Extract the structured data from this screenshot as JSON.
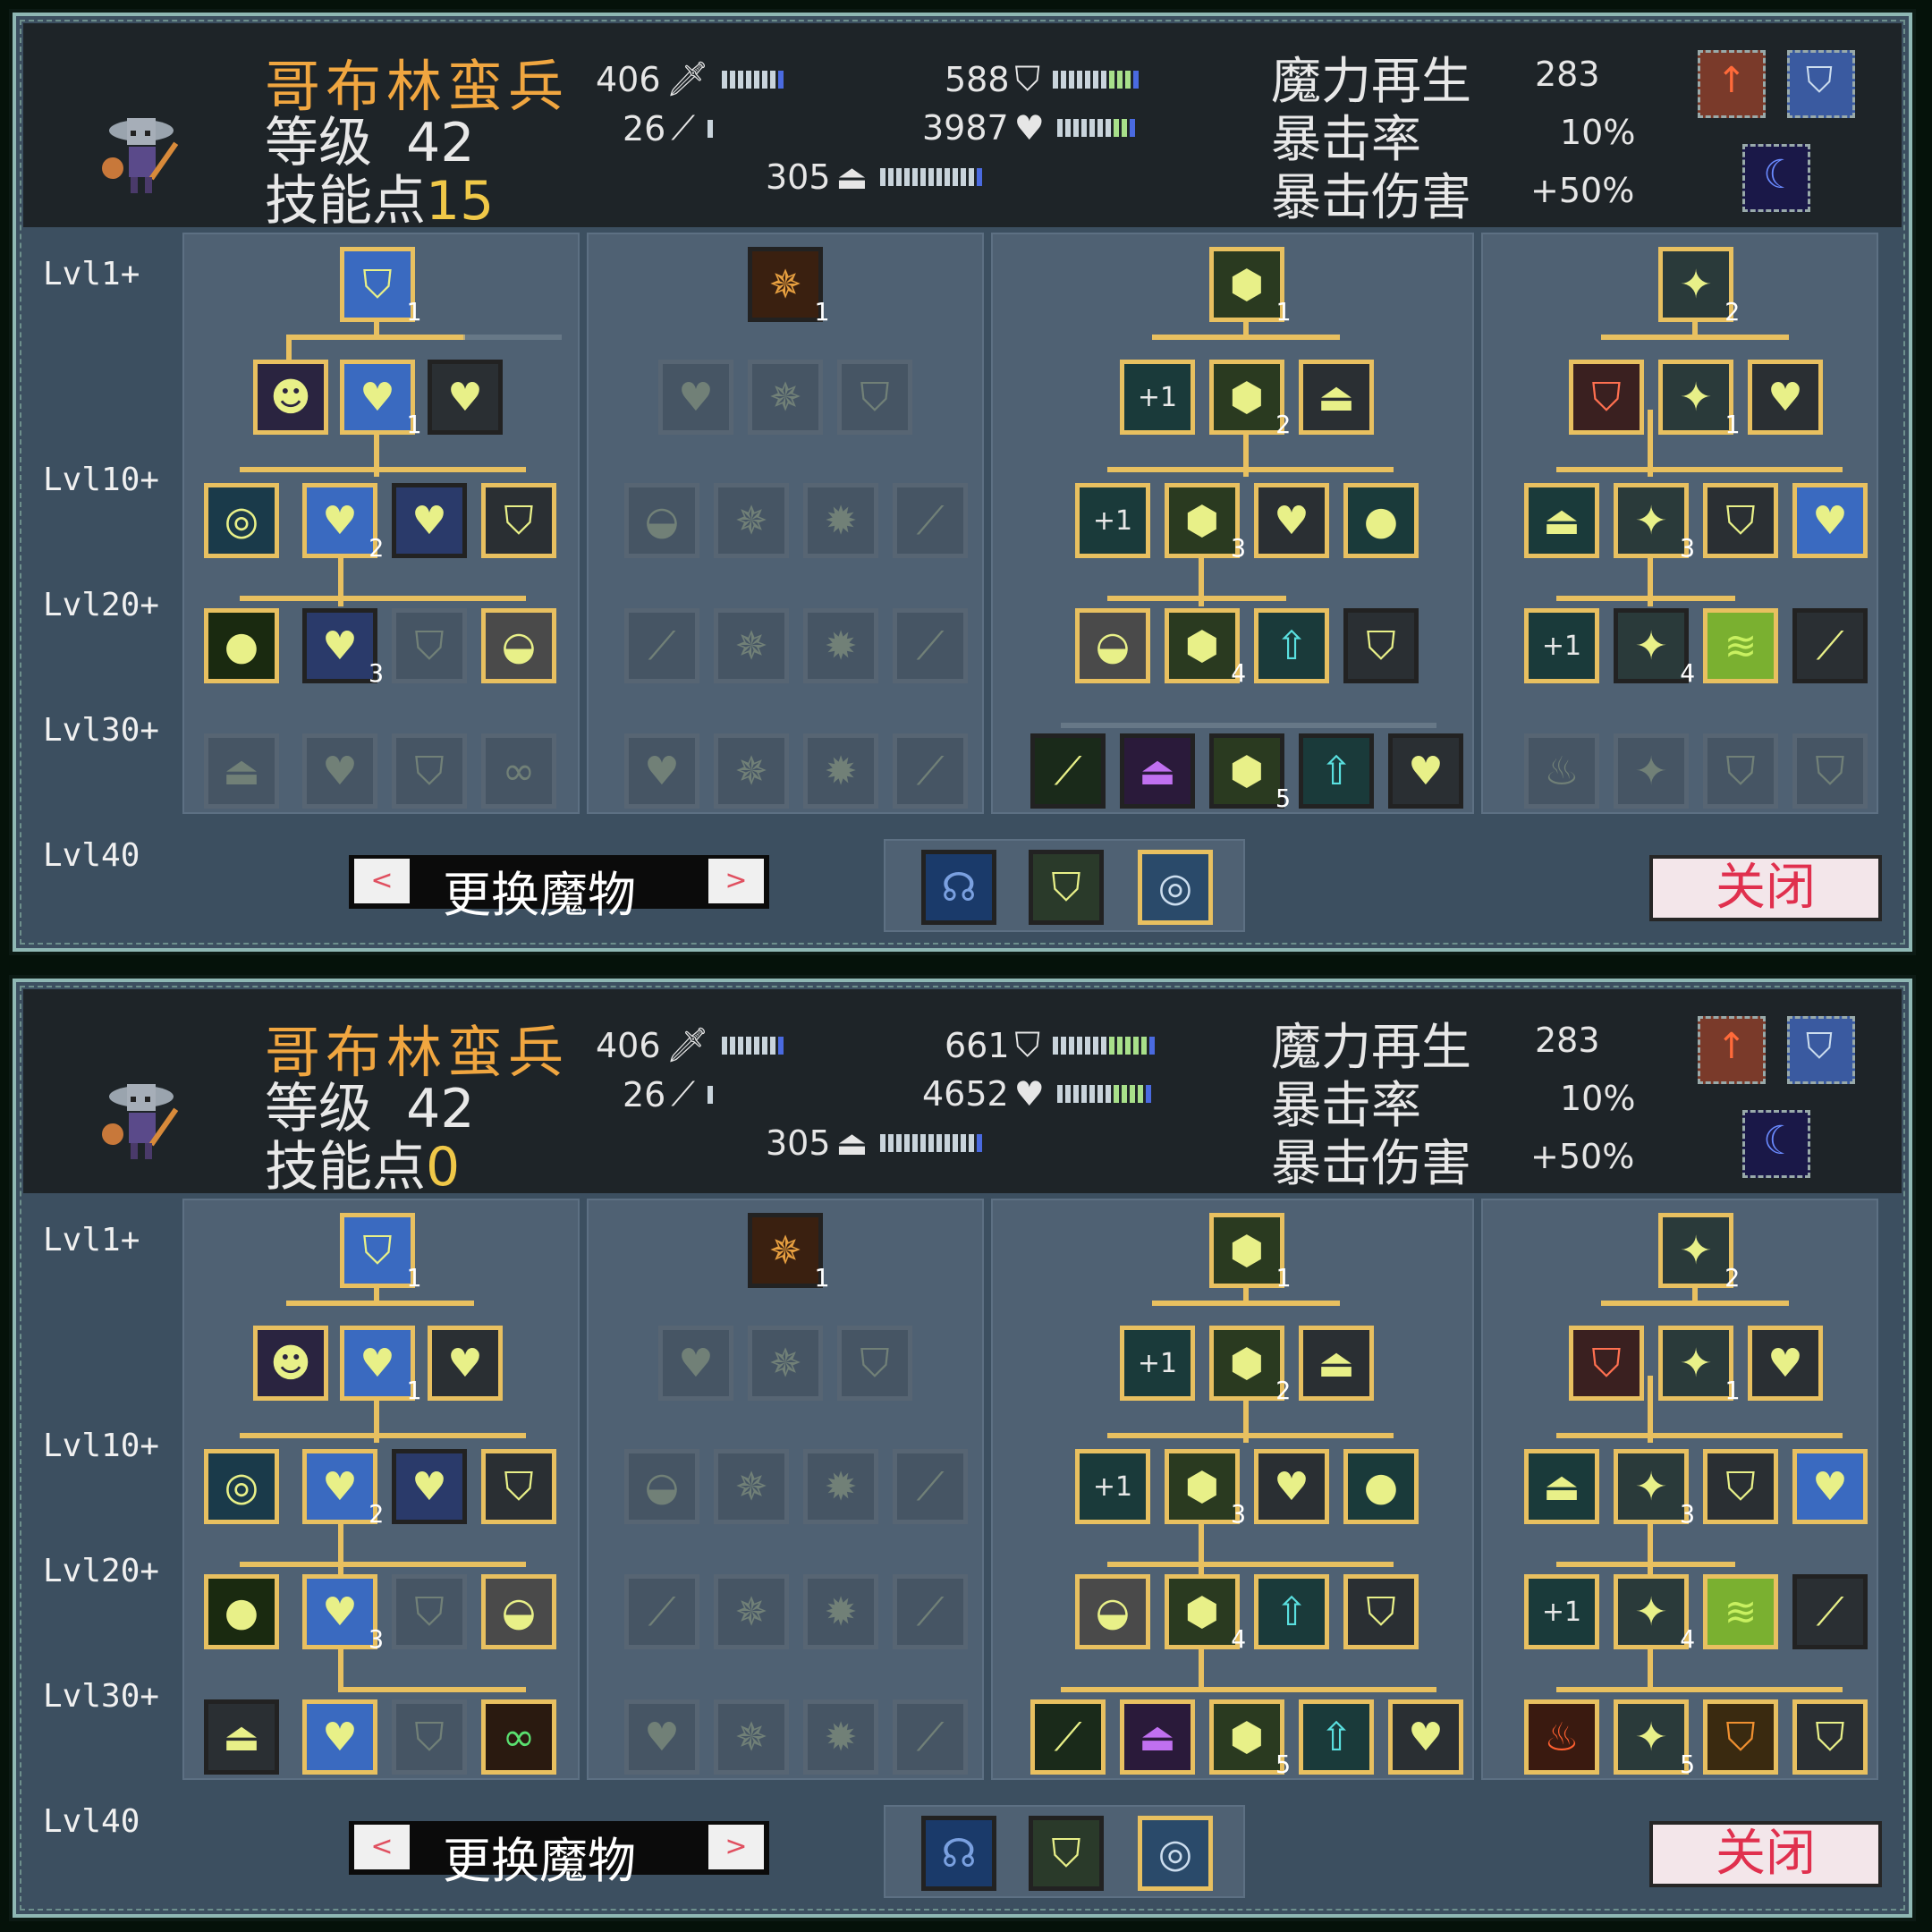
{
  "panels": [
    {
      "monster_name": "哥布林蛮兵",
      "level_label": "等级",
      "level": "42",
      "skill_points_label": "技能点",
      "skill_points": "15",
      "stats": {
        "attack": "406",
        "magic": "26",
        "defense": "588",
        "health": "3987",
        "mana": "305"
      },
      "right_stats": [
        {
          "label": "魔力再生",
          "value": "283"
        },
        {
          "label": "暴击率",
          "value": "10%"
        },
        {
          "label": "暴击伤害",
          "value": "+50%"
        }
      ],
      "row_labels": [
        "Lvl1+",
        "Lvl10+",
        "Lvl20+",
        "Lvl30+",
        "Lvl40"
      ],
      "change_monster": "更换魔物",
      "close": "关闭",
      "nav_left": "<",
      "nav_right": ">"
    },
    {
      "monster_name": "哥布林蛮兵",
      "level_label": "等级",
      "level": "42",
      "skill_points_label": "技能点",
      "skill_points": "0",
      "stats": {
        "attack": "406",
        "magic": "26",
        "defense": "661",
        "health": "4652",
        "mana": "305"
      },
      "right_stats": [
        {
          "label": "魔力再生",
          "value": "283"
        },
        {
          "label": "暴击率",
          "value": "10%"
        },
        {
          "label": "暴击伤害",
          "value": "+50%"
        }
      ],
      "row_labels": [
        "Lvl1+",
        "Lvl10+",
        "Lvl20+",
        "Lvl30+",
        "Lvl40"
      ],
      "change_monster": "更换魔物",
      "close": "关闭",
      "nav_left": "<",
      "nav_right": ">"
    }
  ],
  "icon_counts": [
    "1",
    "1",
    "1",
    "1",
    "2",
    "2",
    "2",
    "1",
    "3",
    "3",
    "3",
    "4",
    "4",
    "5",
    "5"
  ],
  "icon_plus": "+1",
  "colors": {
    "accent": "#e8c060",
    "title": "#f0a640",
    "close_text": "#e0304e"
  }
}
